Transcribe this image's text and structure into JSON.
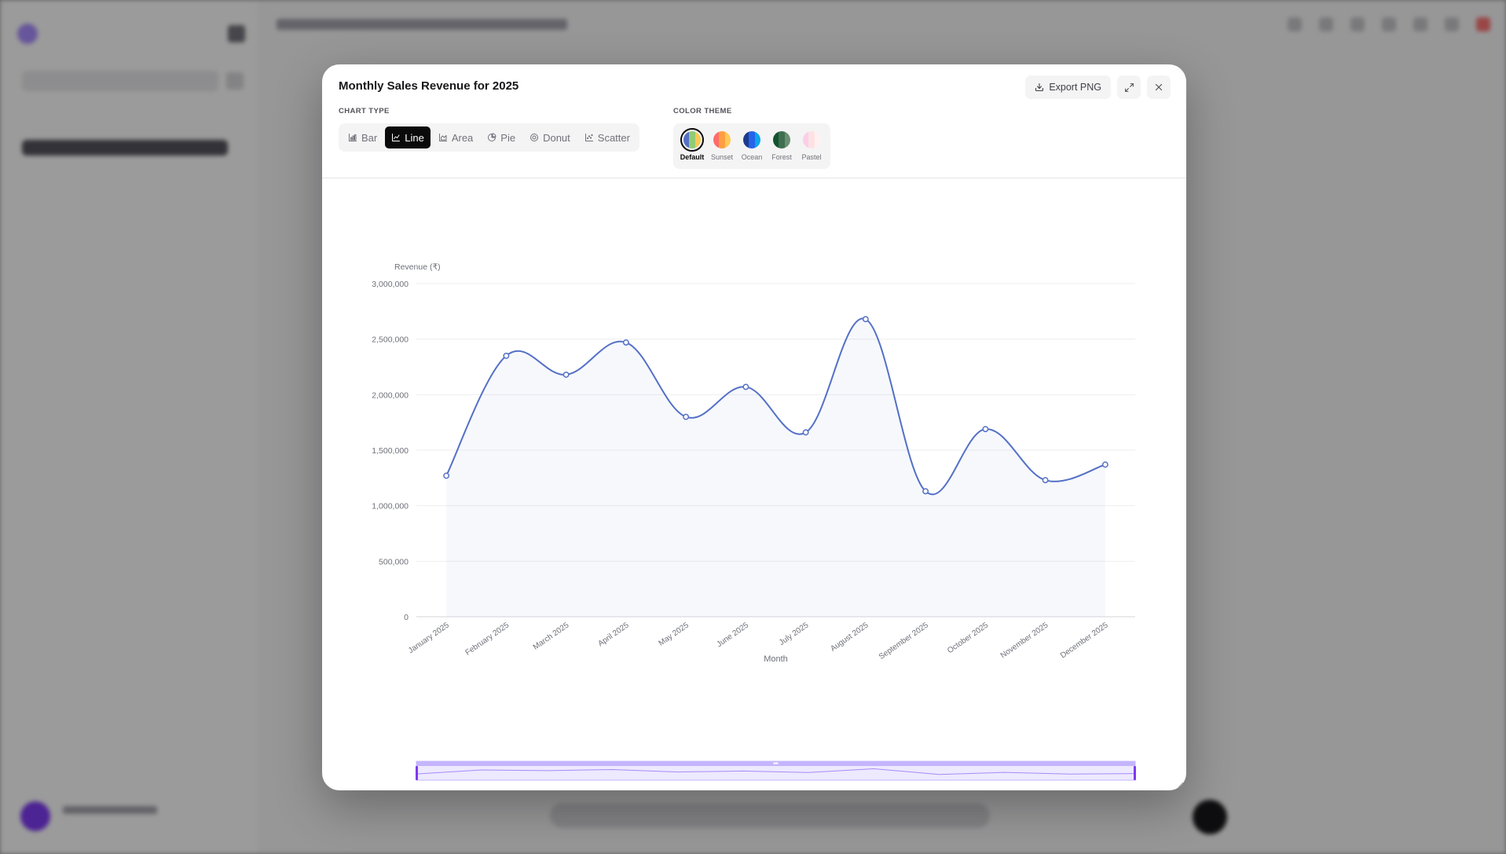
{
  "modal": {
    "title": "Monthly Sales Revenue for 2025",
    "export_label": "Export PNG",
    "chart_type_label": "CHART TYPE",
    "color_theme_label": "COLOR THEME",
    "chart_types": [
      {
        "label": "Bar",
        "icon": "bar-chart-icon",
        "active": false
      },
      {
        "label": "Line",
        "icon": "line-chart-icon",
        "active": true
      },
      {
        "label": "Area",
        "icon": "area-chart-icon",
        "active": false
      },
      {
        "label": "Pie",
        "icon": "pie-chart-icon",
        "active": false
      },
      {
        "label": "Donut",
        "icon": "donut-chart-icon",
        "active": false
      },
      {
        "label": "Scatter",
        "icon": "scatter-chart-icon",
        "active": false
      }
    ],
    "themes": [
      {
        "name": "Default",
        "active": true,
        "colors": [
          "#5470c6",
          "#91cc75",
          "#fac858"
        ]
      },
      {
        "name": "Sunset",
        "active": false,
        "colors": [
          "#ff6b6b",
          "#ff9f43",
          "#feca57"
        ]
      },
      {
        "name": "Ocean",
        "active": false,
        "colors": [
          "#1e3a8a",
          "#2563eb",
          "#0ea5e9"
        ]
      },
      {
        "name": "Forest",
        "active": false,
        "colors": [
          "#14532d",
          "#3f6f4f",
          "#6b8f71"
        ]
      },
      {
        "name": "Pastel",
        "active": false,
        "colors": [
          "#fbcfe8",
          "#fde2e4",
          "#fff1f2"
        ]
      }
    ]
  },
  "chart_data": {
    "type": "line",
    "ylabel": "Revenue (₹)",
    "xlabel": "Month",
    "ylim": [
      0,
      3000000
    ],
    "yticks": [
      "0",
      "500,000",
      "1,000,000",
      "1,500,000",
      "2,000,000",
      "2,500,000",
      "3,000,000"
    ],
    "categories": [
      "January 2025",
      "February 2025",
      "March 2025",
      "April 2025",
      "May 2025",
      "June 2025",
      "July 2025",
      "August 2025",
      "September 2025",
      "October 2025",
      "November 2025",
      "December 2025"
    ],
    "series": [
      {
        "values": [
          1270000,
          2350000,
          2180000,
          2470000,
          1800000,
          2070000,
          1660000,
          2680000,
          1130000,
          1690000,
          1230000,
          1370000
        ],
        "color": "#5470c6"
      }
    ],
    "smooth": true,
    "area_fill": true,
    "grid": true,
    "data_zoom": true
  }
}
